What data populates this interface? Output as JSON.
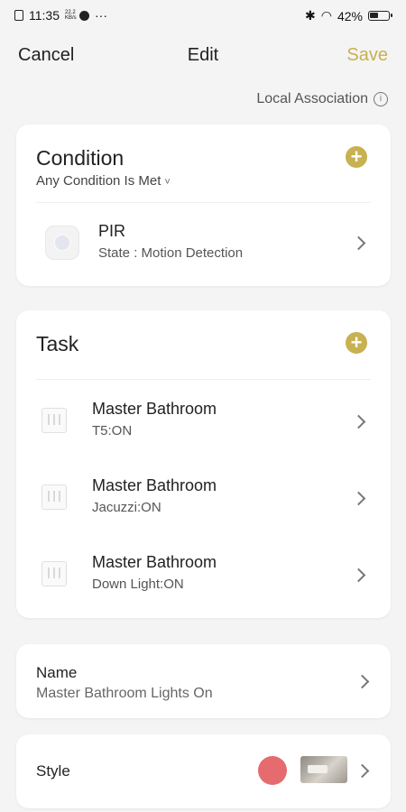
{
  "status_bar": {
    "time": "11:35",
    "signal_small_text": "22.2 KB/s",
    "battery_percent": "42%"
  },
  "nav": {
    "cancel_label": "Cancel",
    "title": "Edit",
    "save_label": "Save"
  },
  "local_association": {
    "label": "Local Association",
    "info_icon": "info-icon"
  },
  "condition": {
    "title": "Condition",
    "mode_label": "Any Condition Is Met",
    "caret": "˅",
    "items": [
      {
        "name": "PIR",
        "state": "State : Motion Detection",
        "icon": "motion-sensor-icon"
      }
    ]
  },
  "task": {
    "title": "Task",
    "items": [
      {
        "name": "Master Bathroom",
        "action": "T5:ON",
        "icon": "wall-switch-icon"
      },
      {
        "name": "Master Bathroom",
        "action": "Jacuzzi:ON",
        "icon": "wall-switch-icon"
      },
      {
        "name": "Master Bathroom",
        "action": "Down Light:ON",
        "icon": "wall-switch-icon"
      }
    ]
  },
  "name_section": {
    "label": "Name",
    "value": "Master Bathroom Lights On"
  },
  "style_section": {
    "label": "Style",
    "color": "#e56b6f"
  },
  "colors": {
    "accent": "#c7b150",
    "background": "#f4f4f5",
    "card": "#ffffff"
  }
}
